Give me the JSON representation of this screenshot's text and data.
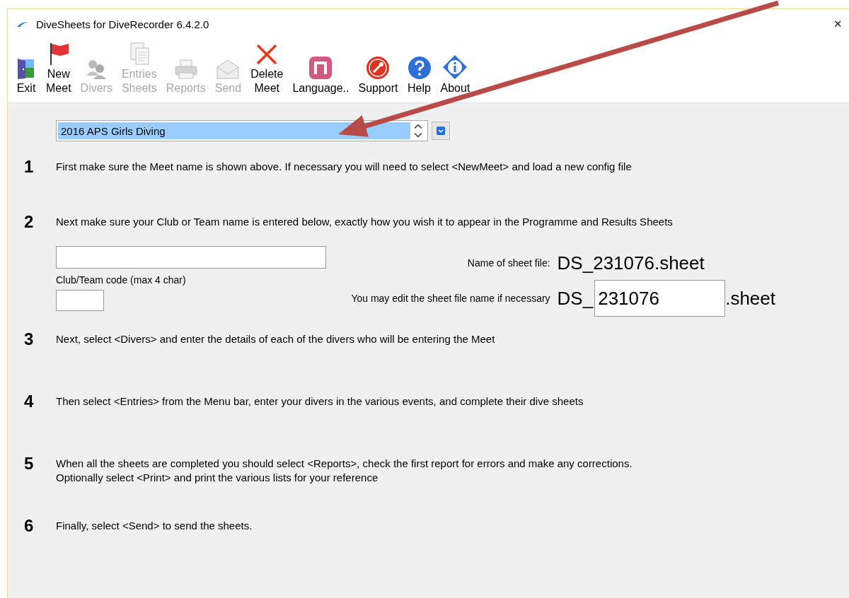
{
  "window": {
    "title": "DiveSheets for DiveRecorder 6.4.2.0",
    "close_glyph": "✕"
  },
  "toolbar": [
    {
      "lines": [
        "Exit"
      ],
      "disabled": false
    },
    {
      "lines": [
        "New",
        "Meet"
      ],
      "disabled": false
    },
    {
      "lines": [
        "Divers"
      ],
      "disabled": true
    },
    {
      "lines": [
        "Entries",
        "Sheets"
      ],
      "disabled": true
    },
    {
      "lines": [
        "Reports"
      ],
      "disabled": true
    },
    {
      "lines": [
        "Send"
      ],
      "disabled": true
    },
    {
      "lines": [
        "Delete",
        "Meet"
      ],
      "disabled": false
    },
    {
      "lines": [
        "Language.."
      ],
      "disabled": false
    },
    {
      "lines": [
        "Support"
      ],
      "disabled": false
    },
    {
      "lines": [
        "Help"
      ],
      "disabled": false
    },
    {
      "lines": [
        "About"
      ],
      "disabled": false
    }
  ],
  "meet_selector": {
    "value": "2016 APS Girls Diving",
    "highlighted": true
  },
  "steps": [
    {
      "number": "1",
      "kind": "plain",
      "lines": [
        "First make sure the Meet name is shown above.  If necessary you will need to select <NewMeet> and load a new config file"
      ]
    },
    {
      "number": "2",
      "kind": "fields",
      "lines": [
        "Next make sure your Club or Team name is entered below, exactly how you wish it to appear in the Programme and Results Sheets"
      ]
    },
    {
      "number": "3",
      "kind": "plain",
      "lines": [
        "Next, select <Divers> and enter the details of each of the divers who will be entering the Meet"
      ]
    },
    {
      "number": "4",
      "kind": "plain",
      "lines": [
        "Then select <Entries> from the Menu bar, enter your divers in the various events, and complete their dive sheets"
      ]
    },
    {
      "number": "5",
      "kind": "plain",
      "lines": [
        "When all the sheets are completed you should select <Reports>, check the first report for errors and make any corrections.",
        "Optionally select <Print> and print the various lists for your reference"
      ]
    },
    {
      "number": "6",
      "kind": "plain",
      "lines": [
        "Finally, select <Send> to send the sheets."
      ]
    }
  ],
  "club": {
    "code_label": "Club/Team code (max 4 char)"
  },
  "sheet_file": {
    "name_label": "Name of sheet file:",
    "name": "DS_231076.sheet",
    "edit_label": "You may edit the sheet file name if necessary",
    "prefix": "DS_",
    "value": "231076",
    "suffix": ".sheet"
  }
}
